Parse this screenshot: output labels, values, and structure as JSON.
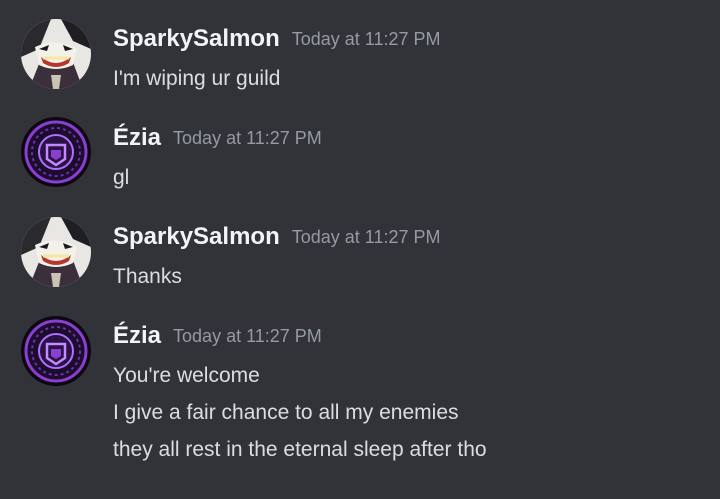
{
  "messages": [
    {
      "author": "SparkySalmon",
      "avatar_icon": "joker-avatar-icon",
      "timestamp": "Today at 11:27 PM",
      "lines": [
        "I'm wiping ur guild"
      ]
    },
    {
      "author": "Ézia",
      "avatar_icon": "purple-sigil-avatar-icon",
      "timestamp": "Today at 11:27 PM",
      "lines": [
        "gl"
      ]
    },
    {
      "author": "SparkySalmon",
      "avatar_icon": "joker-avatar-icon",
      "timestamp": "Today at 11:27 PM",
      "lines": [
        "Thanks"
      ]
    },
    {
      "author": "Ézia",
      "avatar_icon": "purple-sigil-avatar-icon",
      "timestamp": "Today at 11:27 PM",
      "lines": [
        "You're welcome",
        "I give a fair chance to all my enemies",
        "they all rest in the eternal sleep after tho"
      ]
    }
  ],
  "colors": {
    "background": "#313338",
    "username": "#f2f3f5",
    "timestamp": "#949ba4",
    "text": "#dbdee1",
    "sigil_purple": "#8a3fd1"
  }
}
